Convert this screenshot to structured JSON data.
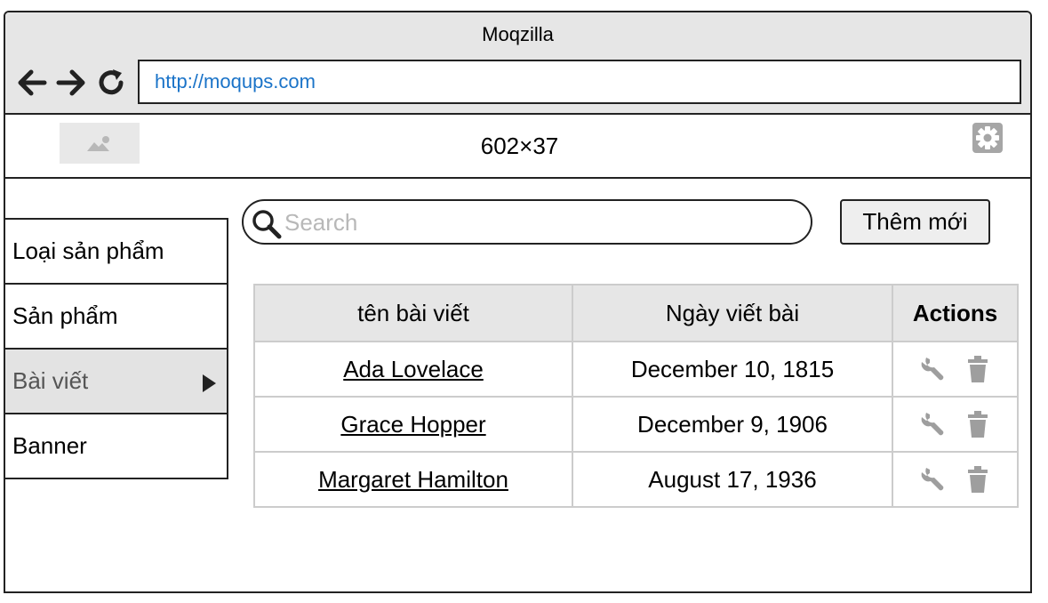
{
  "window": {
    "title": "Moqzilla",
    "url": "http://moqups.com"
  },
  "header": {
    "placeholder_text": "602×37"
  },
  "sidebar": {
    "items": [
      {
        "label": "Loại sản phẩm",
        "active": false
      },
      {
        "label": "Sản phẩm",
        "active": false
      },
      {
        "label": "Bài viết",
        "active": true
      },
      {
        "label": "Banner",
        "active": false
      }
    ]
  },
  "search": {
    "placeholder": "Search",
    "value": ""
  },
  "toolbar": {
    "add_label": "Thêm mới"
  },
  "table": {
    "columns": [
      "tên bài viết",
      "Ngày viết bài",
      "Actions"
    ],
    "rows": [
      {
        "title": "Ada Lovelace",
        "date": "December 10, 1815"
      },
      {
        "title": "Grace Hopper",
        "date": "December 9, 1906"
      },
      {
        "title": "Margaret Hamilton",
        "date": "August 17, 1936"
      }
    ]
  },
  "icons": {
    "back": "arrow-left-icon",
    "forward": "arrow-right-icon",
    "reload": "reload-icon",
    "settings": "gear-icon",
    "search": "search-icon",
    "edit": "wrench-icon",
    "delete": "trash-icon",
    "image": "image-icon"
  },
  "colors": {
    "url_text": "#1a73c8",
    "chrome_bg": "#e6e6e6",
    "active_menu_bg": "#e3e3e3",
    "icon_gray": "#9e9e9e"
  }
}
